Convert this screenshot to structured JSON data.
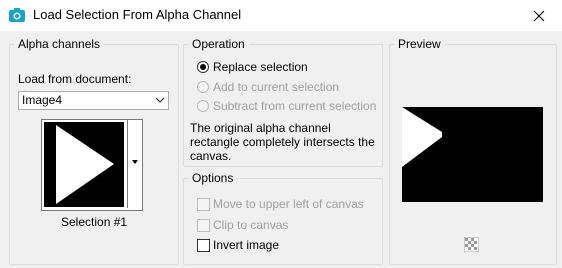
{
  "window": {
    "title": "Load Selection From Alpha Channel"
  },
  "alpha_channels": {
    "legend": "Alpha channels",
    "load_label": "Load from document:",
    "document_value": "Image4",
    "selection_name": "Selection #1"
  },
  "operation": {
    "legend": "Operation",
    "options": [
      {
        "label": "Replace selection",
        "selected": true,
        "enabled": true
      },
      {
        "label": "Add to current selection",
        "selected": false,
        "enabled": false
      },
      {
        "label": "Subtract from current selection",
        "selected": false,
        "enabled": false
      }
    ],
    "description": "The original alpha channel rectangle completely intersects the canvas."
  },
  "options": {
    "legend": "Options",
    "items": [
      {
        "label": "Move to upper left of canvas",
        "checked": false,
        "enabled": false
      },
      {
        "label": "Clip to canvas",
        "checked": false,
        "enabled": false
      },
      {
        "label": "Invert image",
        "checked": false,
        "enabled": true
      }
    ]
  },
  "preview": {
    "legend": "Preview"
  },
  "icons": {
    "app": "psp-app-icon",
    "close": "close-icon",
    "dropdown": "chevron-down-icon",
    "thumb_menu": "triangle-down-icon",
    "preview_toggle": "checkerboard-icon"
  }
}
